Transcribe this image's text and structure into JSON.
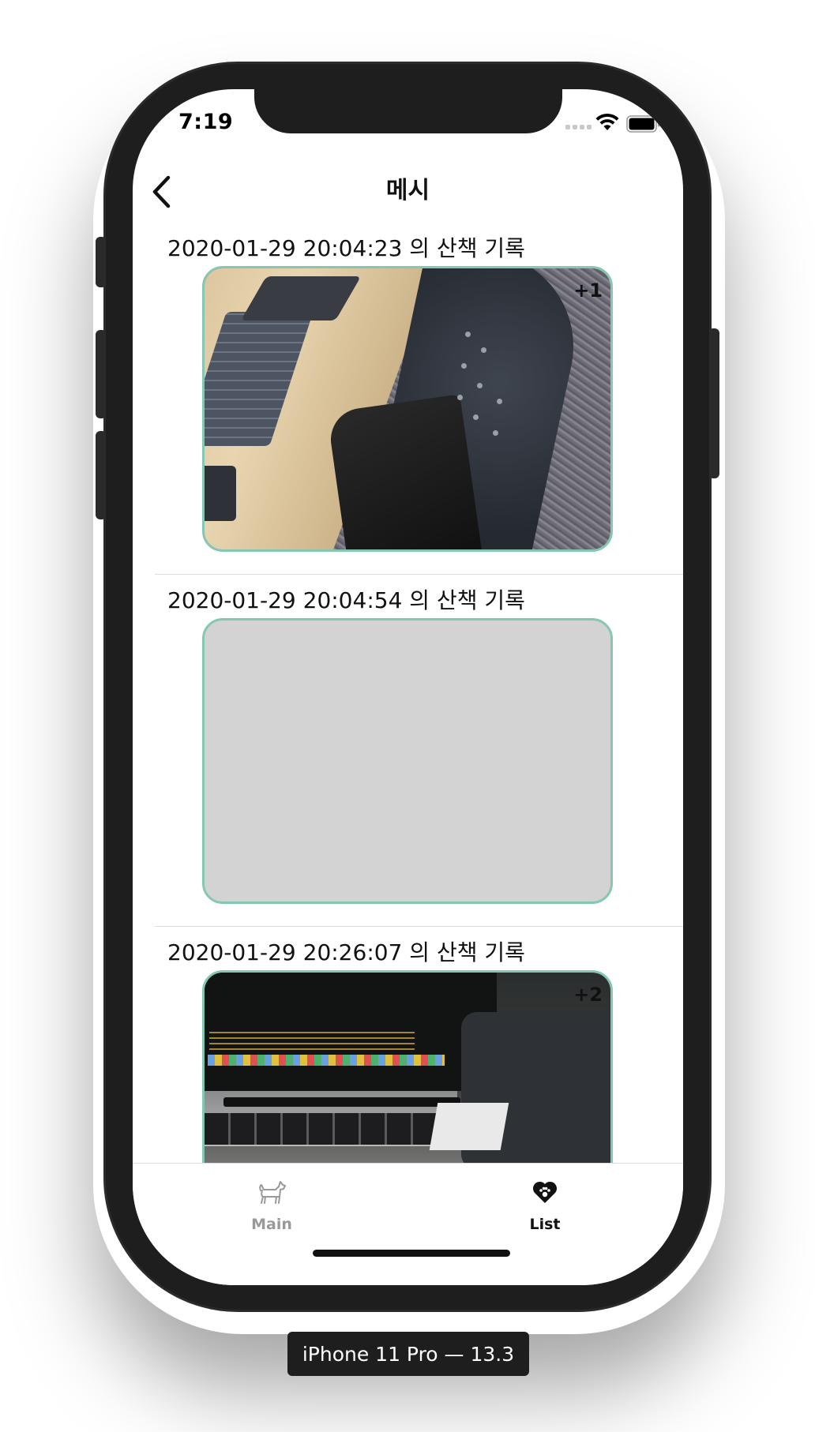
{
  "device": {
    "label": "iPhone 11 Pro — 13.3"
  },
  "status_bar": {
    "time": "7:19"
  },
  "nav": {
    "title": "메시",
    "back_icon": "chevron-left-icon"
  },
  "walks": [
    {
      "title": "2020-01-29 20:04:23 의 산책 기록",
      "badge": "+1",
      "photo": "desk-and-chair-photo"
    },
    {
      "title": "2020-01-29 20:04:54 의 산책 기록",
      "badge": "",
      "photo": "empty-placeholder"
    },
    {
      "title": "2020-01-29 20:26:07 의 산책 기록",
      "badge": "+2",
      "photo": "laptop-photo"
    }
  ],
  "tab_bar": {
    "tabs": [
      {
        "label": "Main",
        "icon": "dog-icon",
        "selected": false,
        "color": "#999999"
      },
      {
        "label": "List",
        "icon": "heart-paw-icon",
        "selected": true,
        "color": "#111111"
      }
    ]
  },
  "colors": {
    "card_border": "#86c7b4",
    "placeholder": "#d3d3d3"
  }
}
